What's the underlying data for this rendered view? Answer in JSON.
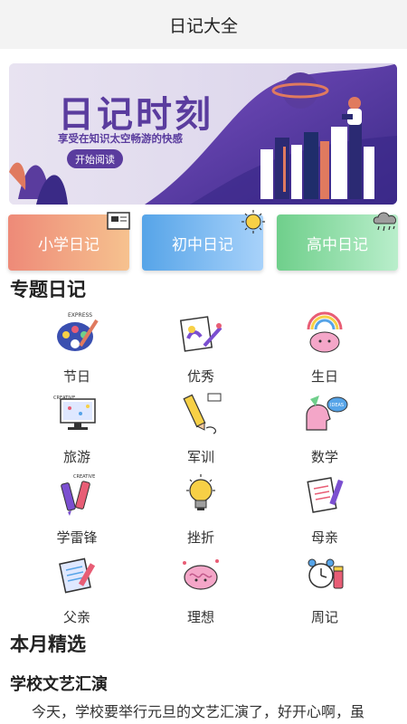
{
  "app": {
    "title": "日记大全"
  },
  "banner": {
    "title": "日记时刻",
    "subtitle": "享受在知识太空畅游的快感",
    "button_label": "开始阅读"
  },
  "grades": [
    {
      "label": "小学日记",
      "icon": "blackboard-icon"
    },
    {
      "label": "初中日记",
      "icon": "sun-icon"
    },
    {
      "label": "高中日记",
      "icon": "cloud-rain-icon"
    }
  ],
  "topics_section": {
    "title": "专题日记",
    "items": [
      {
        "label": "节日",
        "icon": "palette-icon"
      },
      {
        "label": "优秀",
        "icon": "sketchbook-icon"
      },
      {
        "label": "生日",
        "icon": "brain-rainbow-icon"
      },
      {
        "label": "旅游",
        "icon": "monitor-icon"
      },
      {
        "label": "军训",
        "icon": "pencil-icon"
      },
      {
        "label": "数学",
        "icon": "head-chat-icon"
      },
      {
        "label": "学雷锋",
        "icon": "markers-icon"
      },
      {
        "label": "挫折",
        "icon": "lightbulb-icon"
      },
      {
        "label": "母亲",
        "icon": "notebook-icon"
      },
      {
        "label": "父亲",
        "icon": "notepad-icon"
      },
      {
        "label": "理想",
        "icon": "brain-icon"
      },
      {
        "label": "周记",
        "icon": "alarm-clock-icon"
      }
    ]
  },
  "monthly_section": {
    "title": "本月精选",
    "article": {
      "title": "学校文艺汇演",
      "excerpt": "今天，学校要举行元旦的文艺汇演了，好开心啊，虽"
    }
  },
  "colors": {
    "banner_purple": "#5a3c9e",
    "grade1": "#ee8a78",
    "grade2": "#56a4e8",
    "grade3": "#6fcf8b"
  }
}
